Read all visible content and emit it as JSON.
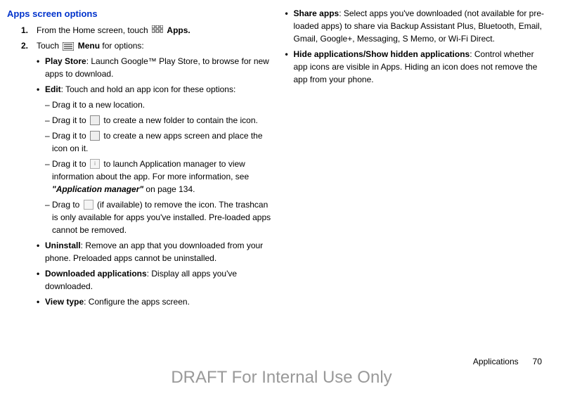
{
  "section_title": "Apps screen options",
  "step1": {
    "num": "1.",
    "prefix": "From the Home screen, touch ",
    "apps_label": "Apps."
  },
  "step2": {
    "num": "2.",
    "prefix": "Touch ",
    "menu_label": "Menu",
    "suffix": " for options:"
  },
  "playstore": {
    "label": "Play Store",
    "text": ": Launch Google™ Play Store, to browse for new apps to download."
  },
  "edit": {
    "label": "Edit",
    "text": ": Touch and hold an app icon for these options:"
  },
  "sub1": "Drag it to a new location.",
  "sub2a": "Drag it to ",
  "sub2b": " to create a new folder to contain the icon.",
  "sub3a": "Drag it to ",
  "sub3b": " to create a new apps screen and place the icon on it.",
  "sub4a": "Drag it to ",
  "sub4b": " to launch Application manager to view information about the app. For more information, see ",
  "sub4c": "\"Application manager\"",
  "sub4d": " on page 134.",
  "sub5a": "Drag to ",
  "sub5b": " (if available) to remove the icon. The trashcan is only available for apps you've installed. Pre-loaded apps cannot be removed.",
  "uninstall": {
    "label": "Uninstall",
    "text": ": Remove an app that you downloaded from your phone. Preloaded apps cannot be uninstalled."
  },
  "downloaded": {
    "label": "Downloaded applications",
    "text": ": Display all apps you've downloaded."
  },
  "viewtype": {
    "label": "View type",
    "text": ": Configure the apps screen."
  },
  "shareapps": {
    "label": "Share apps",
    "text": ": Select apps you've downloaded (not available for pre-loaded apps) to share via Backup Assistant Plus, Bluetooth, Email, Gmail, Google+, Messaging, S Memo, or Wi-Fi Direct."
  },
  "hideapps": {
    "label": "Hide applications/Show hidden applications",
    "text": ": Control whether app icons are visible in Apps. Hiding an icon does not remove the app from your phone."
  },
  "footer_section": "Applications",
  "footer_page": "70",
  "watermark": "DRAFT For Internal Use Only"
}
